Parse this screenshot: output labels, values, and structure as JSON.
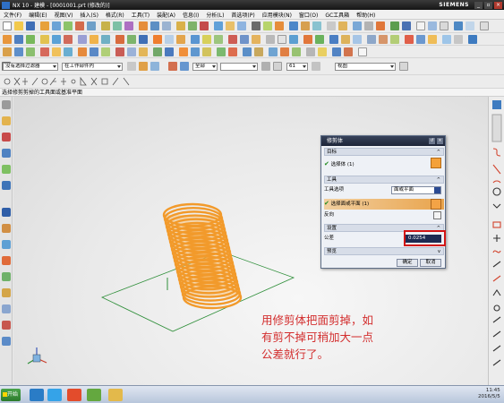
{
  "window": {
    "title": "NX 10 - 建模 - [0001001.prt (修改的)]",
    "brand": "SIEMENS",
    "buttons": {
      "minimize": "_",
      "restore": "▫",
      "close": "×"
    }
  },
  "menubar": {
    "items": [
      "文件(F)",
      "编辑(E)",
      "视图(V)",
      "插入(S)",
      "格式(R)",
      "工具(T)",
      "装配(A)",
      "信息(I)",
      "分析(L)",
      "首选项(P)",
      "应用模块(N)",
      "窗口(O)",
      "GC工具箱",
      "帮助(H)"
    ]
  },
  "toolbar": {
    "filter_combo": "没有选择过滤器",
    "scope_combo": "在工作部件内",
    "snap_combo": "全部",
    "extra_combo": "",
    "layer_combo": "61",
    "view_combo": "视图"
  },
  "cue_line": "选择修剪剪掉的工具面或基准平面",
  "dialog": {
    "title": "修剪体",
    "title_buttons": {
      "reset": "↺",
      "close": "×"
    },
    "target_section": "目标",
    "select_body": "选择体 (1)",
    "tool_section": "工具",
    "tool_option_label": "工具选项",
    "tool_option_value": "面或平面",
    "select_face": "选择面或平面 (1)",
    "reverse_label": "反向",
    "settings_section": "设置",
    "tolerance_label": "公差",
    "tolerance_value": "0.0254",
    "preview_section": "预览",
    "ok_button": "确定",
    "cancel_button": "取消"
  },
  "annotation": {
    "line1": "用修剪体把面剪掉，如",
    "line2": "有剪不掉可稍加大一点",
    "line3": "公差就行了。"
  },
  "taskbar": {
    "start": "开始",
    "time": "11:45",
    "date": "2016/5/5"
  },
  "colors": {
    "spring": "#f29a2b",
    "title_bar": "#1d2538",
    "tolerance_highlight": "#d21414",
    "annotation": "#d32f2f"
  }
}
